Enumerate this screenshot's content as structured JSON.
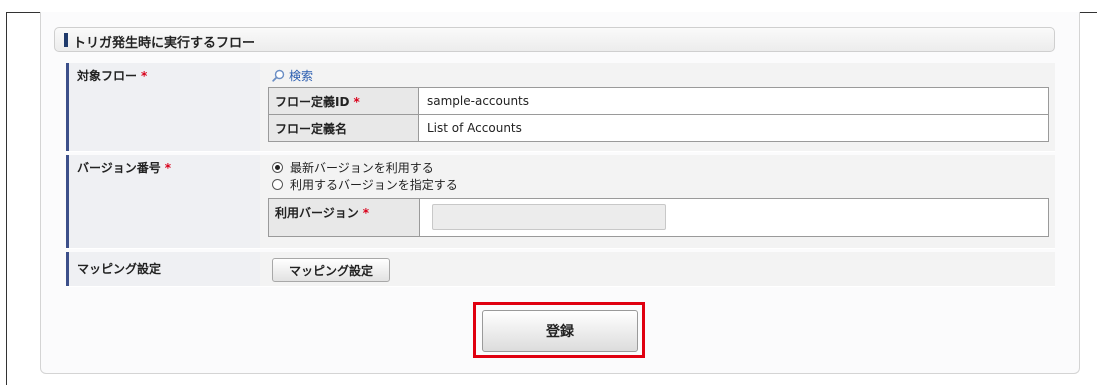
{
  "section": {
    "title": "トリガ発生時に実行するフロー"
  },
  "form": {
    "target_flow": {
      "label": "対象フロー",
      "required_mark": "*",
      "search_label": "検索",
      "rows": [
        {
          "header": "フロー定義ID",
          "required_mark": "*",
          "value": "sample-accounts"
        },
        {
          "header": "フロー定義名",
          "required_mark": "",
          "value": "List of Accounts"
        }
      ]
    },
    "version": {
      "label": "バージョン番号",
      "required_mark": "*",
      "options": [
        {
          "label": "最新バージョンを利用する",
          "checked": true
        },
        {
          "label": "利用するバージョンを指定する",
          "checked": false
        }
      ],
      "use_version_label": "利用バージョン",
      "use_version_required_mark": "*",
      "use_version_value": ""
    },
    "mapping": {
      "label": "マッピング設定",
      "button_label": "マッピング設定"
    }
  },
  "submit": {
    "label": "登録",
    "highlight_color": "#e00010"
  },
  "colors": {
    "accent": "#3c4f8a",
    "required": "#d9001a",
    "link": "#2a5db0"
  }
}
